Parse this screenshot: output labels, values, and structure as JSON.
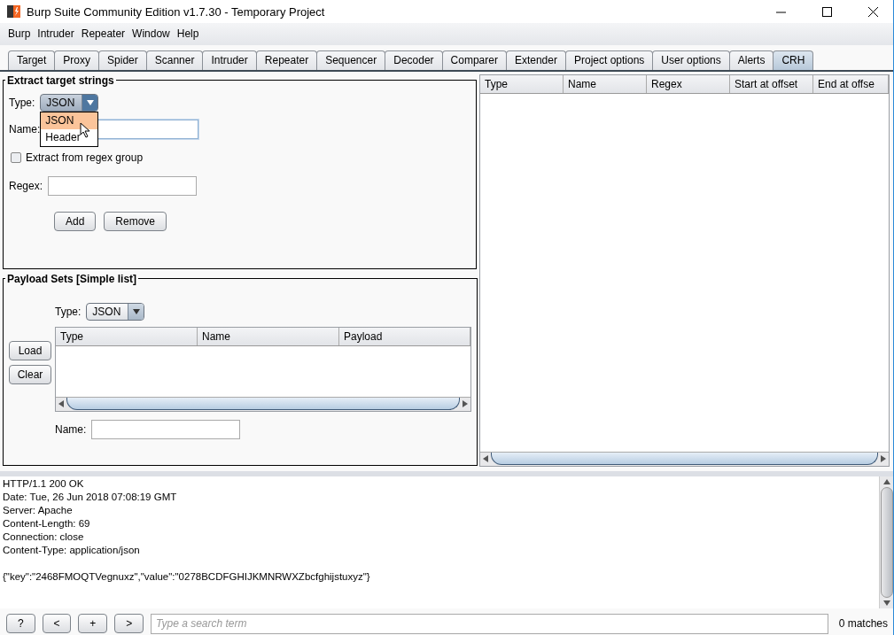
{
  "window": {
    "title": "Burp Suite Community Edition v1.7.30 - Temporary Project"
  },
  "menu": [
    "Burp",
    "Intruder",
    "Repeater",
    "Window",
    "Help"
  ],
  "tabs": [
    {
      "label": "Target",
      "selected": false
    },
    {
      "label": "Proxy",
      "selected": false
    },
    {
      "label": "Spider",
      "selected": false
    },
    {
      "label": "Scanner",
      "selected": false
    },
    {
      "label": "Intruder",
      "selected": false
    },
    {
      "label": "Repeater",
      "selected": false
    },
    {
      "label": "Sequencer",
      "selected": false
    },
    {
      "label": "Decoder",
      "selected": false
    },
    {
      "label": "Comparer",
      "selected": false
    },
    {
      "label": "Extender",
      "selected": false
    },
    {
      "label": "Project options",
      "selected": false
    },
    {
      "label": "User options",
      "selected": false
    },
    {
      "label": "Alerts",
      "selected": false
    },
    {
      "label": "CRH",
      "selected": true
    }
  ],
  "extract": {
    "title": "Extract target strings",
    "type_label": "Type:",
    "type_value": "JSON",
    "options": [
      {
        "label": "JSON",
        "selected": true
      },
      {
        "label": "Header",
        "selected": false
      }
    ],
    "name_label": "Name:",
    "checkbox": {
      "label": "Extract from regex group",
      "checked": false
    },
    "regex_label": "Regex:",
    "buttons": [
      "Add",
      "Remove"
    ]
  },
  "payload_sets": {
    "title": "Payload Sets [Simple list]",
    "type_label": "Type:",
    "type_value": "JSON",
    "buttons": [
      "Load",
      "Clear"
    ],
    "columns": [
      "Type",
      "Name",
      "Payload"
    ],
    "name_label": "Name:"
  },
  "targets_table": {
    "columns": [
      "Type",
      "Name",
      "Regex",
      "Start at offset",
      "End at offse"
    ]
  },
  "response": {
    "headers": [
      "HTTP/1.1 200 OK",
      "Date: Tue, 26 Jun 2018 07:08:19 GMT",
      "Server: Apache",
      "Content-Length: 69",
      "Connection: close",
      "Content-Type: application/json"
    ],
    "body": "{\"key\":\"2468FMOQTVegnuxz\",\"value\":\"0278BCDFGHIJKMNRWXZbcfghijstuxyz\"}"
  },
  "search": {
    "buttons": [
      "?",
      "<",
      "+",
      ">"
    ],
    "placeholder": "Type a search term",
    "matches": "0 matches"
  }
}
